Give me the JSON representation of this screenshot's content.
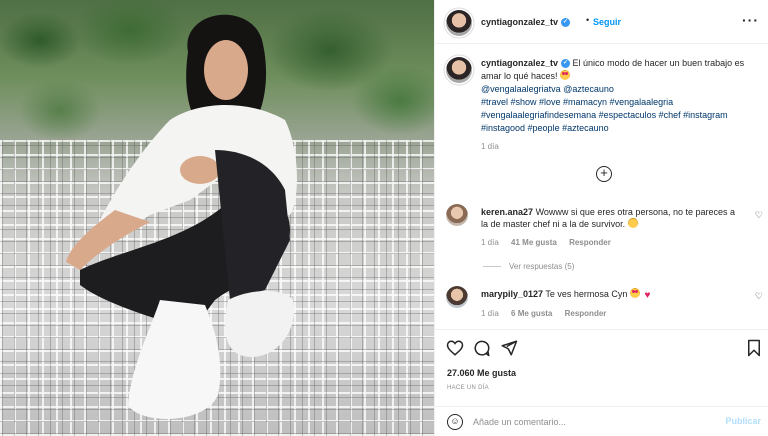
{
  "post": {
    "username": "cyntiagonzalez_tv",
    "follow_label": "Seguir",
    "more_label": "···",
    "caption": {
      "text_before": "El único modo de hacer un buen trabajo es amar lo qué haces!",
      "mentions": [
        "@vengalaalegriatva",
        "@aztecauno"
      ],
      "hashtags": "#travel #show #love #mamacyn #vengalaalegria #vengalaalegriafindesemana #espectaculos #chef #instagram #instagood #people #aztecauno",
      "time": "1 día"
    },
    "load_more_label": "+",
    "comments": [
      {
        "username": "keren.ana27",
        "text": "Wowww si que eres otra persona, no te pareces a la de master chef ni a la de survivor.",
        "time": "1 día",
        "likes": "41 Me gusta",
        "reply_label": "Responder",
        "view_replies": "Ver respuestas (5)"
      },
      {
        "username": "marypily_0127",
        "text": "Te ves hermosa Cyn",
        "time": "1 día",
        "likes": "6 Me gusta",
        "reply_label": "Responder"
      }
    ],
    "likes_count": "27.060 Me gusta",
    "posted_ago": "HACE UN DÍA",
    "comment_placeholder": "Añade un comentario...",
    "publish_label": "Publicar"
  },
  "colors": {
    "link_blue": "#0095f6",
    "tag_blue": "#00376b",
    "muted": "#8e8e8e",
    "verified": "#3897f0",
    "publish_disabled": "#b2dffc"
  },
  "icons": [
    "heart-outline-icon",
    "comment-icon",
    "share-icon",
    "bookmark-icon",
    "smile-icon",
    "verified-icon",
    "plus-circle-icon"
  ]
}
